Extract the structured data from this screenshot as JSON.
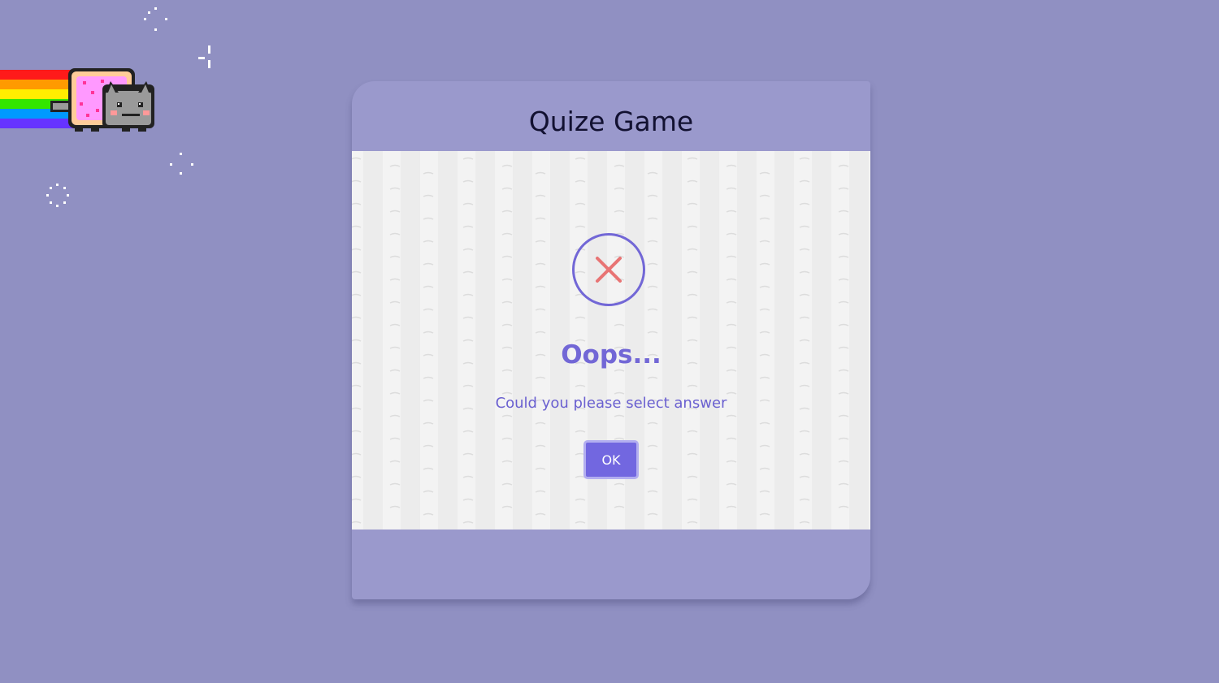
{
  "page": {
    "background_color": "#9090c2"
  },
  "card": {
    "title": "Quize Game",
    "background_color": "#9a99cc"
  },
  "alert": {
    "icon": "error-x-icon",
    "title": "Oops...",
    "message": "Could you please select answer",
    "ok_label": "OK",
    "accent_color": "#7267d6",
    "icon_x_color": "#e87474"
  },
  "decorations": {
    "mascot": "nyan-cat-icon",
    "sparkles": [
      "sparkle-icon",
      "sparkle-icon",
      "sparkle-icon",
      "sparkle-icon"
    ]
  }
}
